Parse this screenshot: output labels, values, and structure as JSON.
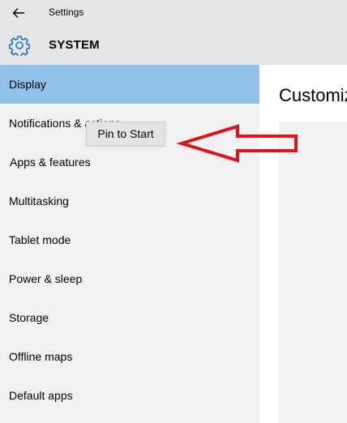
{
  "window": {
    "title": "Settings",
    "back_icon": "back-arrow-icon"
  },
  "header": {
    "icon": "gear-icon",
    "title": "SYSTEM",
    "accent_color": "#1a6fc9"
  },
  "sidebar": {
    "selected_color": "#91c0e8",
    "items": [
      {
        "label": "Display",
        "selected": true
      },
      {
        "label": "Notifications & actions",
        "selected": false
      },
      {
        "label": "Apps & features",
        "selected": false
      },
      {
        "label": "Multitasking",
        "selected": false
      },
      {
        "label": "Tablet mode",
        "selected": false
      },
      {
        "label": "Power & sleep",
        "selected": false
      },
      {
        "label": "Storage",
        "selected": false
      },
      {
        "label": "Offline maps",
        "selected": false
      },
      {
        "label": "Default apps",
        "selected": false
      }
    ]
  },
  "main": {
    "heading": "Customize your display"
  },
  "context_menu": {
    "items": [
      {
        "label": "Pin to Start"
      }
    ]
  },
  "annotation": {
    "shape": "arrow-left",
    "color": "#e0121b"
  }
}
